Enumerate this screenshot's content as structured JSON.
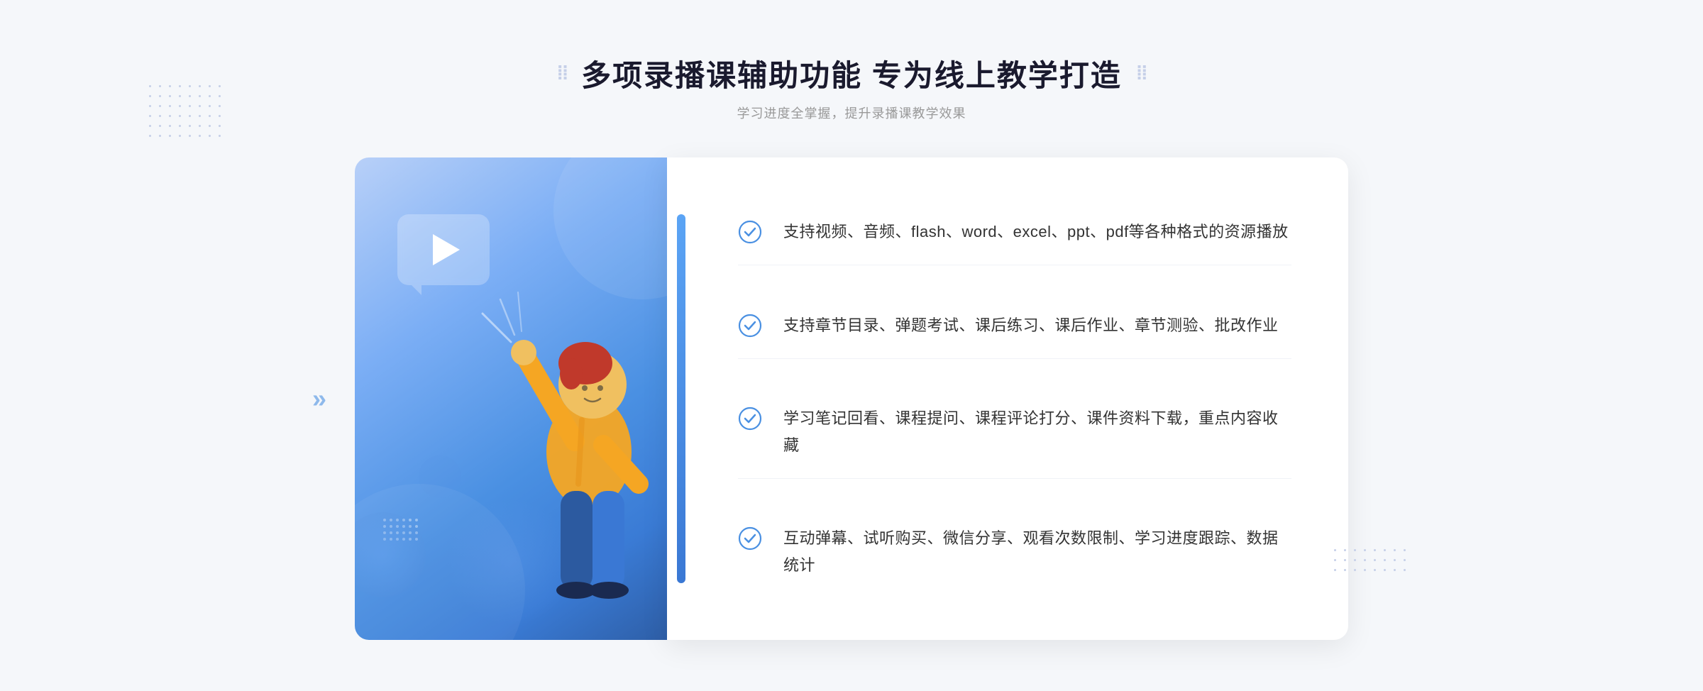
{
  "page": {
    "background_color": "#f5f7fa"
  },
  "header": {
    "main_title": "多项录播课辅助功能 专为线上教学打造",
    "sub_title": "学习进度全掌握，提升录播课教学效果",
    "deco_left": "⁞⁞",
    "deco_right": "⁞⁞"
  },
  "features": [
    {
      "id": 1,
      "text": "支持视频、音频、flash、word、excel、ppt、pdf等各种格式的资源播放"
    },
    {
      "id": 2,
      "text": "支持章节目录、弹题考试、课后练习、课后作业、章节测验、批改作业"
    },
    {
      "id": 3,
      "text": "学习笔记回看、课程提问、课程评论打分、课件资料下载，重点内容收藏"
    },
    {
      "id": 4,
      "text": "互动弹幕、试听购买、微信分享、观看次数限制、学习进度跟踪、数据统计"
    }
  ],
  "icons": {
    "check_circle": "check-circle-icon",
    "play": "play-icon",
    "chevron": "chevron-left-icon"
  },
  "colors": {
    "primary_blue": "#4a90e2",
    "dark_blue": "#3a78d4",
    "light_blue": "#b8d0f8",
    "text_dark": "#333333",
    "text_light": "#999999",
    "white": "#ffffff"
  }
}
